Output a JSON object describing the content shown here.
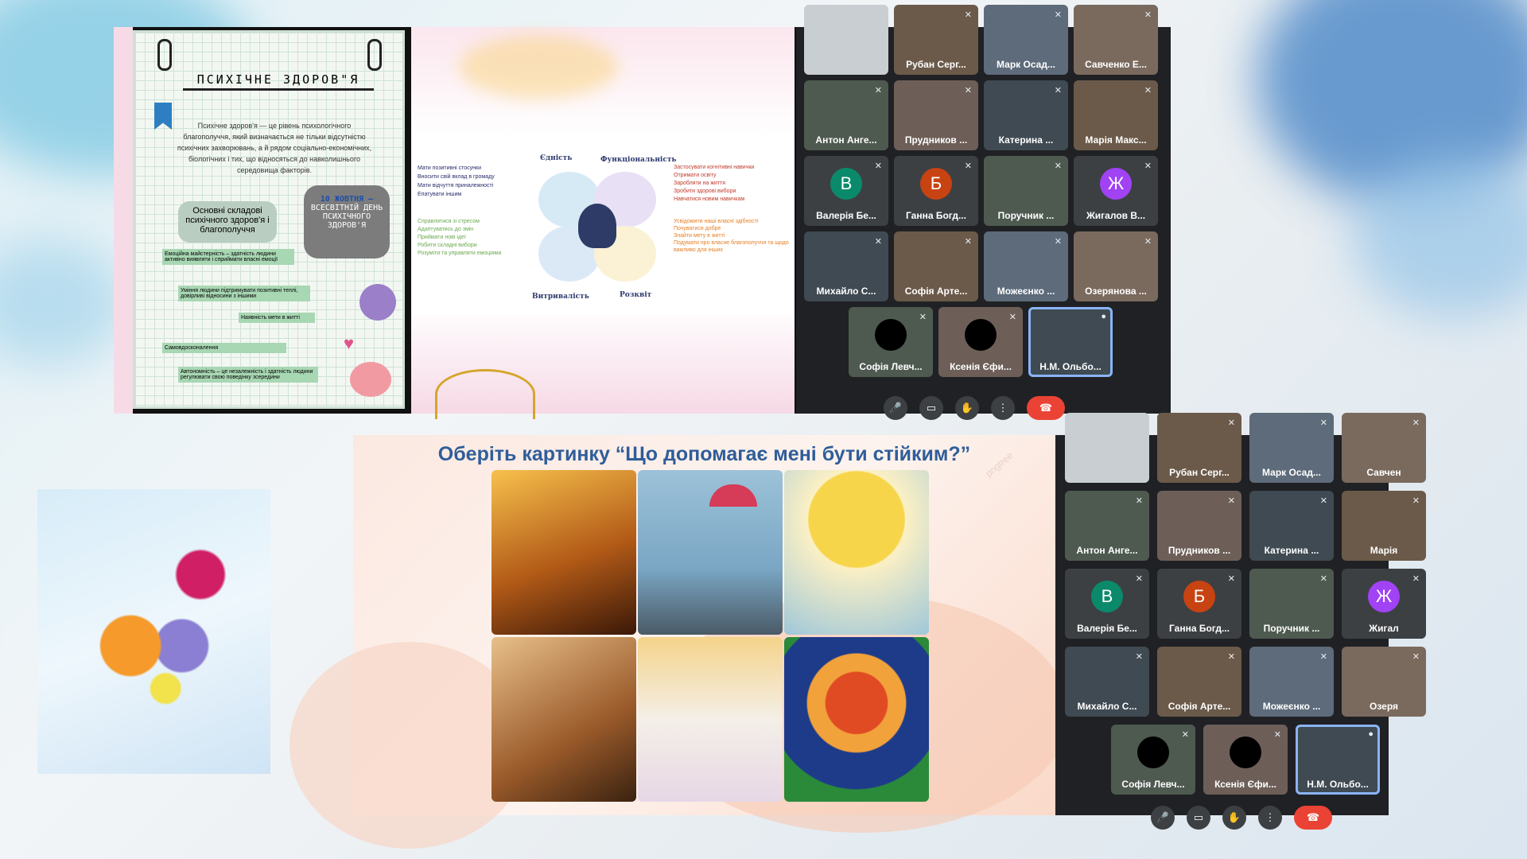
{
  "top_slide": {
    "poster_title": "ПСИХІЧНЕ ЗДОРОВ\"Я",
    "poster_intro": "Психічне здоров'я — це рівень психологічного благополуччя, який визначається не тільки відсутністю психічних захворювань, а й рядом соціально-економічних, біологічних і тих, що відносяться до навколишнього середовища факторів.",
    "components_label": "Основні складові психічного здоров'я і благополуччя",
    "date_label_1": "10 ЖОВТНЯ –",
    "date_label_2": "ВСЕСВІТНІЙ ДЕНЬ ПСИХІЧНОГО ЗДОРОВ'Я",
    "note_1": "Емоційна майстерність – здатність людини активно виявляти і сприймати власні емоції",
    "note_2": "Уміння людини підтримувати позитивні теплі, довірливі відносини з іншими",
    "note_3": "Наявність мети в житті",
    "note_4": "Самовдосконалення",
    "note_5": "Автономність – це незалежність і здатність людини регулювати свою поведінку зсередини",
    "diagram": {
      "labels": [
        "Єдність",
        "Функціональність",
        "Витривалість",
        "Розквіт"
      ],
      "left_top": [
        "Мати позитивні стосунки",
        "Вносити свій вклад в громаду",
        "Мати відчуття приналежності",
        "Епатувати іншим"
      ],
      "left_bottom": [
        "Справлятися зі стресом",
        "Адаптуватись до змін",
        "Приймати нові ідеї",
        "Робити складні вибори",
        "Розуміти та управляти емоціями"
      ],
      "right_top": [
        "Застосувати когнітивні навички",
        "Отримати освіту",
        "Заробляти на життя",
        "Зробити здорові вибори",
        "Навчатися новим навичкам"
      ],
      "right_bottom": [
        "Усвідомити наші власні здібності",
        "Почуватися добре",
        "Знайти мету в житті",
        "Подумати про власне благополуччя та щодо важливо для інших"
      ]
    }
  },
  "meet_top": {
    "tiles": [
      {
        "name": "Рубан Серг..."
      },
      {
        "name": "Марк Осад..."
      },
      {
        "name": "Савченко Е..."
      },
      {
        "name": "Антон Анге..."
      },
      {
        "name": "Прудников ..."
      },
      {
        "name": "Катерина ..."
      },
      {
        "name": "Марія Макс..."
      },
      {
        "name": "Валерія Бе...",
        "initial": "В"
      },
      {
        "name": "Ганна Богд...",
        "initial": "Б"
      },
      {
        "name": "Поручник ..."
      },
      {
        "name": "Жигалов В...",
        "initial": "Ж"
      },
      {
        "name": "Михайло С..."
      },
      {
        "name": "Софія Арте..."
      },
      {
        "name": "Можеєнко ..."
      },
      {
        "name": "Озерянова ..."
      },
      {
        "name": "Софія Левч..."
      },
      {
        "name": "Ксенія Єфи..."
      },
      {
        "name": "Н.М. Ольбо..."
      }
    ]
  },
  "bottom_slide": {
    "title": "Оберіть картинку “Що допомагає мені бути стійким?”",
    "watermark": "pngtree"
  },
  "meet_bottom": {
    "tiles": [
      {
        "name": "Рубан Серг..."
      },
      {
        "name": "Марк Осад..."
      },
      {
        "name": "Савчен"
      },
      {
        "name": "Антон Анге..."
      },
      {
        "name": "Прудников ..."
      },
      {
        "name": "Катерина ..."
      },
      {
        "name": "Марія"
      },
      {
        "name": "Валерія Бе...",
        "initial": "В"
      },
      {
        "name": "Ганна Богд...",
        "initial": "Б"
      },
      {
        "name": "Поручник ..."
      },
      {
        "name": "Жигал",
        "initial": "Ж"
      },
      {
        "name": "Михайло С..."
      },
      {
        "name": "Софія Арте..."
      },
      {
        "name": "Можеєнко ..."
      },
      {
        "name": "Озеря"
      },
      {
        "name": "Софія Левч..."
      },
      {
        "name": "Ксенія Єфи..."
      },
      {
        "name": "Н.М. Ольбо..."
      }
    ]
  },
  "colors": {
    "avatar_green": "#0b8a6b",
    "avatar_orange": "#c84312",
    "avatar_purple": "#a142f4",
    "end_call": "#ea4335",
    "active_border": "#8ab4f8",
    "title_blue": "#2f5d9a"
  }
}
